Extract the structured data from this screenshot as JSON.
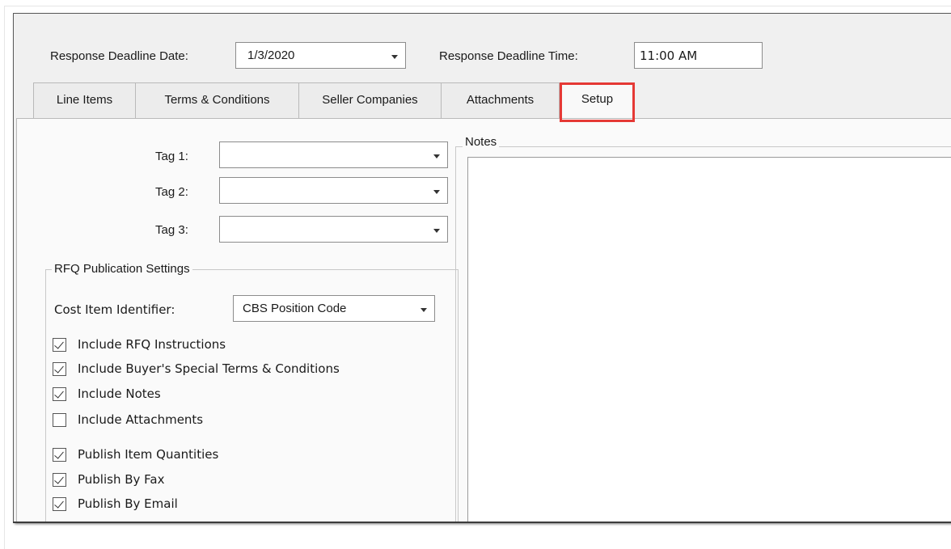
{
  "header": {
    "deadline_date_label": "Response Deadline Date:",
    "deadline_date_value": "1/3/2020",
    "deadline_time_label": "Response Deadline Time:",
    "deadline_time_value": "11:00 AM"
  },
  "tabs": [
    {
      "label": "Line Items",
      "active": false
    },
    {
      "label": "Terms & Conditions",
      "active": false
    },
    {
      "label": "Seller Companies",
      "active": false
    },
    {
      "label": "Attachments",
      "active": false
    },
    {
      "label": "Setup",
      "active": true
    }
  ],
  "tags": [
    {
      "label": "Tag 1:",
      "value": ""
    },
    {
      "label": "Tag 2:",
      "value": ""
    },
    {
      "label": "Tag 3:",
      "value": ""
    }
  ],
  "publication": {
    "title": "RFQ Publication Settings",
    "cost_item_label": "Cost Item Identifier:",
    "cost_item_value": "CBS Position Code",
    "options": [
      {
        "label": "Include RFQ Instructions",
        "checked": true
      },
      {
        "label": "Include Buyer's Special Terms & Conditions",
        "checked": true
      },
      {
        "label": "Include Notes",
        "checked": true
      },
      {
        "label": "Include Attachments",
        "checked": false
      },
      {
        "label": "Publish Item Quantities",
        "checked": true
      },
      {
        "label": "Publish By Fax",
        "checked": true
      },
      {
        "label": "Publish By Email",
        "checked": true
      }
    ]
  },
  "notes": {
    "title": "Notes",
    "value": ""
  },
  "colors": {
    "highlight": "#e53935",
    "window_bg": "#f0f0f0"
  }
}
